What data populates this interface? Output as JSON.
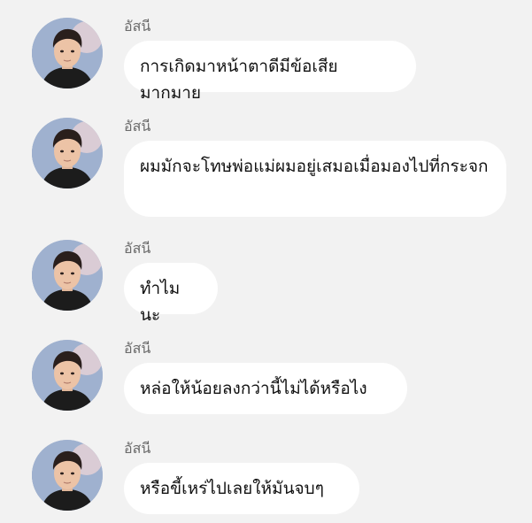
{
  "messages": [
    {
      "sender": "อัสนี",
      "text": "การเกิดมาหน้าตาดีมีข้อเสียมากมาย"
    },
    {
      "sender": "อัสนี",
      "text": "ผมมักจะโทษพ่อแม่ผมอยู่เสมอเมื่อมองไปที่กระจก"
    },
    {
      "sender": "อัสนี",
      "text": "ทำไมนะ"
    },
    {
      "sender": "อัสนี",
      "text": "หล่อให้น้อยลงกว่านี้ไม่ได้หรือไง"
    },
    {
      "sender": "อัสนี",
      "text": "หรือขี้เหร่ไปเลยให้มันจบๆ"
    }
  ],
  "colors": {
    "background": "#f2f2f2",
    "bubble": "#ffffff",
    "sender_text": "#6b6b6b",
    "message_text": "#111111"
  },
  "icons": {
    "avatar": "profile-photo-avatar"
  }
}
